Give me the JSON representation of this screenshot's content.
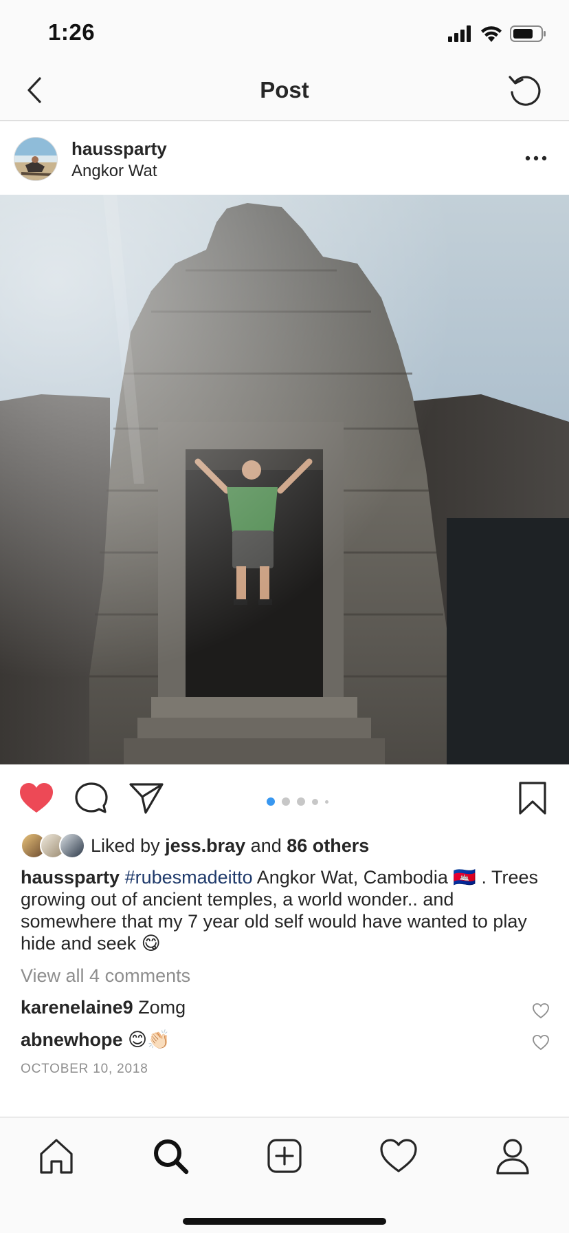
{
  "status_bar": {
    "time": "1:26",
    "icons": [
      "signal-icon",
      "wifi-icon",
      "battery-icon"
    ]
  },
  "nav": {
    "title": "Post",
    "back_icon": "chevron-left-icon",
    "refresh_icon": "refresh-icon"
  },
  "post": {
    "username": "haussparty",
    "location": "Angkor Wat",
    "more_icon": "ellipsis-icon",
    "carousel": {
      "total": 5,
      "active": 1
    },
    "liked": true,
    "likes": {
      "prefix": "Liked by ",
      "user": "jess.bray",
      "middle": " and ",
      "others": "86 others"
    },
    "caption": {
      "username": "haussparty",
      "hashtag": "#rubesmadeitto",
      "text": " Angkor Wat, Cambodia 🇰🇭 . Trees growing out of ancient temples, a world wonder.. and somewhere that my 7 year old self would have wanted to play hide and seek 😋"
    },
    "view_comments": "View all 4 comments",
    "comments": [
      {
        "user": "karenelaine9",
        "text": "Zomg"
      },
      {
        "user": "abnewhope",
        "text": "😊👏🏻"
      }
    ],
    "date": "OCTOBER 10, 2018"
  },
  "colors": {
    "like_red": "#ed4956",
    "hashtag_blue": "#1f3a6b",
    "dot_active": "#3897f0",
    "muted_gray": "#8e8e8e"
  },
  "tabs": [
    "home-icon",
    "search-icon",
    "add-post-icon",
    "activity-heart-icon",
    "profile-icon"
  ]
}
